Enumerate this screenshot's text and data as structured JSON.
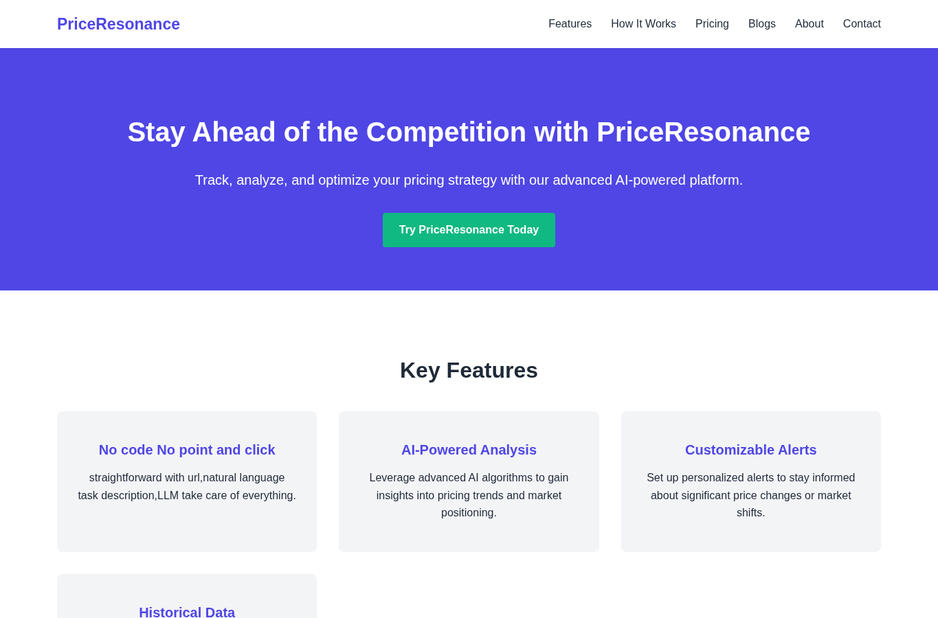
{
  "nav": {
    "brand": "PriceResonance",
    "links": [
      "Features",
      "How It Works",
      "Pricing",
      "Blogs",
      "About",
      "Contact"
    ]
  },
  "hero": {
    "title": "Stay Ahead of the Competition with PriceResonance",
    "subtitle": "Track, analyze, and optimize your pricing strategy with our advanced AI-powered platform.",
    "cta": "Try PriceResonance Today"
  },
  "features": {
    "heading": "Key Features",
    "cards": [
      {
        "title": "No code No point and click",
        "text": "straightforward with url,natural language task description,LLM take care of everything."
      },
      {
        "title": "AI-Powered Analysis",
        "text": "Leverage advanced AI algorithms to gain insights into pricing trends and market positioning."
      },
      {
        "title": "Customizable Alerts",
        "text": "Set up personalized alerts to stay informed about significant price changes or market shifts."
      },
      {
        "title": "Historical Data"
      }
    ]
  }
}
